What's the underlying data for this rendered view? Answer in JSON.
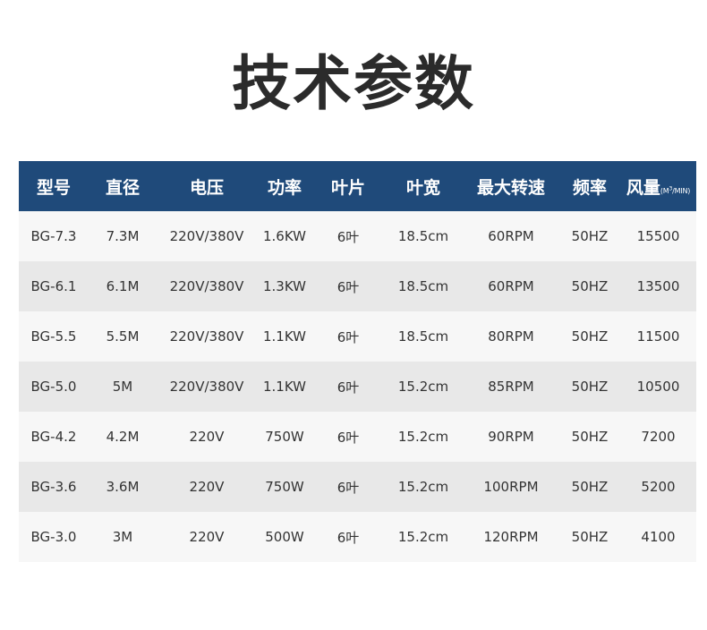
{
  "title": "技术参数",
  "table": {
    "headers": {
      "model": "型号",
      "diameter": "直径",
      "voltage": "电压",
      "power": "功率",
      "blades": "叶片",
      "blade_width": "叶宽",
      "max_speed": "最大转速",
      "frequency": "频率",
      "airflow": "风量",
      "airflow_unit_open": "(M",
      "airflow_unit_exp": "3",
      "airflow_unit_close": "/MIN)"
    },
    "rows": [
      [
        "BG-7.3",
        "7.3M",
        "220V/380V",
        "1.6KW",
        "6叶",
        "18.5cm",
        "60RPM",
        "50HZ",
        "15500"
      ],
      [
        "BG-6.1",
        "6.1M",
        "220V/380V",
        "1.3KW",
        "6叶",
        "18.5cm",
        "60RPM",
        "50HZ",
        "13500"
      ],
      [
        "BG-5.5",
        "5.5M",
        "220V/380V",
        "1.1KW",
        "6叶",
        "18.5cm",
        "80RPM",
        "50HZ",
        "11500"
      ],
      [
        "BG-5.0",
        "5M",
        "220V/380V",
        "1.1KW",
        "6叶",
        "15.2cm",
        "85RPM",
        "50HZ",
        "10500"
      ],
      [
        "BG-4.2",
        "4.2M",
        "220V",
        "750W",
        "6叶",
        "15.2cm",
        "90RPM",
        "50HZ",
        "7200"
      ],
      [
        "BG-3.6",
        "3.6M",
        "220V",
        "750W",
        "6叶",
        "15.2cm",
        "100RPM",
        "50HZ",
        "5200"
      ],
      [
        "BG-3.0",
        "3M",
        "220V",
        "500W",
        "6叶",
        "15.2cm",
        "120RPM",
        "50HZ",
        "4100"
      ]
    ]
  },
  "colors": {
    "header_bg": "#1f4a7a",
    "row_light": "#f7f7f7",
    "row_dark": "#e8e8e8"
  }
}
